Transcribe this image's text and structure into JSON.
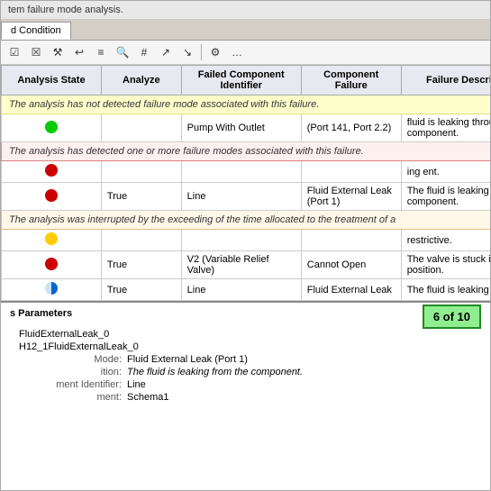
{
  "title": "tem failure mode analysis.",
  "tabs": [
    {
      "label": "d Condition",
      "active": true
    }
  ],
  "toolbar": {
    "buttons": [
      "☑",
      "☒",
      "🔧",
      "↩",
      "≡",
      "🔍",
      "#",
      "↗",
      "↘",
      "⚙",
      "…"
    ]
  },
  "table": {
    "headers": [
      {
        "label": "Analysis State"
      },
      {
        "label": "Analyze"
      },
      {
        "label": "Failed Component Identifier"
      },
      {
        "label": "Component Failure"
      },
      {
        "label": "Failure Description"
      }
    ],
    "notifications": {
      "n1": "The analysis has not detected failure mode associated with this failure.",
      "n2": "The analysis has detected one or more failure modes associated with this failure.",
      "n3": "The analysis was interrupted by the exceeding of the time allocated to the treatment of a"
    },
    "rows": [
      {
        "dot": "green",
        "analyze": "",
        "failed_comp": "Pump With Outlet",
        "comp_failure": "(Port 141, Port 2.2)",
        "failure_desc": "fluid is leaking through the component.",
        "notification": "n1",
        "notif_type": "yellow"
      },
      {
        "dot": "red",
        "analyze": "",
        "failed_comp": "",
        "comp_failure": "",
        "failure_desc": "ing ent.",
        "notification": "n2",
        "notif_type": "red"
      },
      {
        "dot": "red",
        "analyze": "True",
        "failed_comp": "Line",
        "comp_failure": "Fluid External Leak (Port 1)",
        "failure_desc": "The fluid is leaking from the component.",
        "notification": null,
        "notif_type": null
      },
      {
        "dot": "yellow",
        "analyze": "",
        "failed_comp": "",
        "comp_failure": "",
        "failure_desc": "restrictive.",
        "notification": "n3",
        "notif_type": "orange"
      },
      {
        "dot": "red",
        "analyze": "True",
        "failed_comp": "V2 (Variable Relief Valve)",
        "comp_failure": "Cannot Open",
        "failure_desc": "The valve is stuck in closed position.",
        "notification": null,
        "notif_type": null
      },
      {
        "dot": "blue_spin",
        "analyze": "True",
        "failed_comp": "Line",
        "comp_failure": "Fluid External Leak",
        "failure_desc": "The fluid is leaking ponent. d port is leaking le aking t. aking nponent.",
        "notification": null,
        "notif_type": null
      }
    ]
  },
  "bottom": {
    "title": "s Parameters",
    "counter": "6 of 10",
    "standalone1": "FluidExternalLeak_0",
    "standalone2": "H12_1FluidExternalLeak_0",
    "params": [
      {
        "label": "Mode:",
        "value": "Fluid External Leak (Port 1)",
        "italic": false
      },
      {
        "label": "ition:",
        "value": "The fluid is leaking from the component.",
        "italic": true
      },
      {
        "label": "ment Identifier:",
        "value": "Line",
        "italic": false
      },
      {
        "label": "ment:",
        "value": "Schema1",
        "italic": false
      }
    ]
  }
}
